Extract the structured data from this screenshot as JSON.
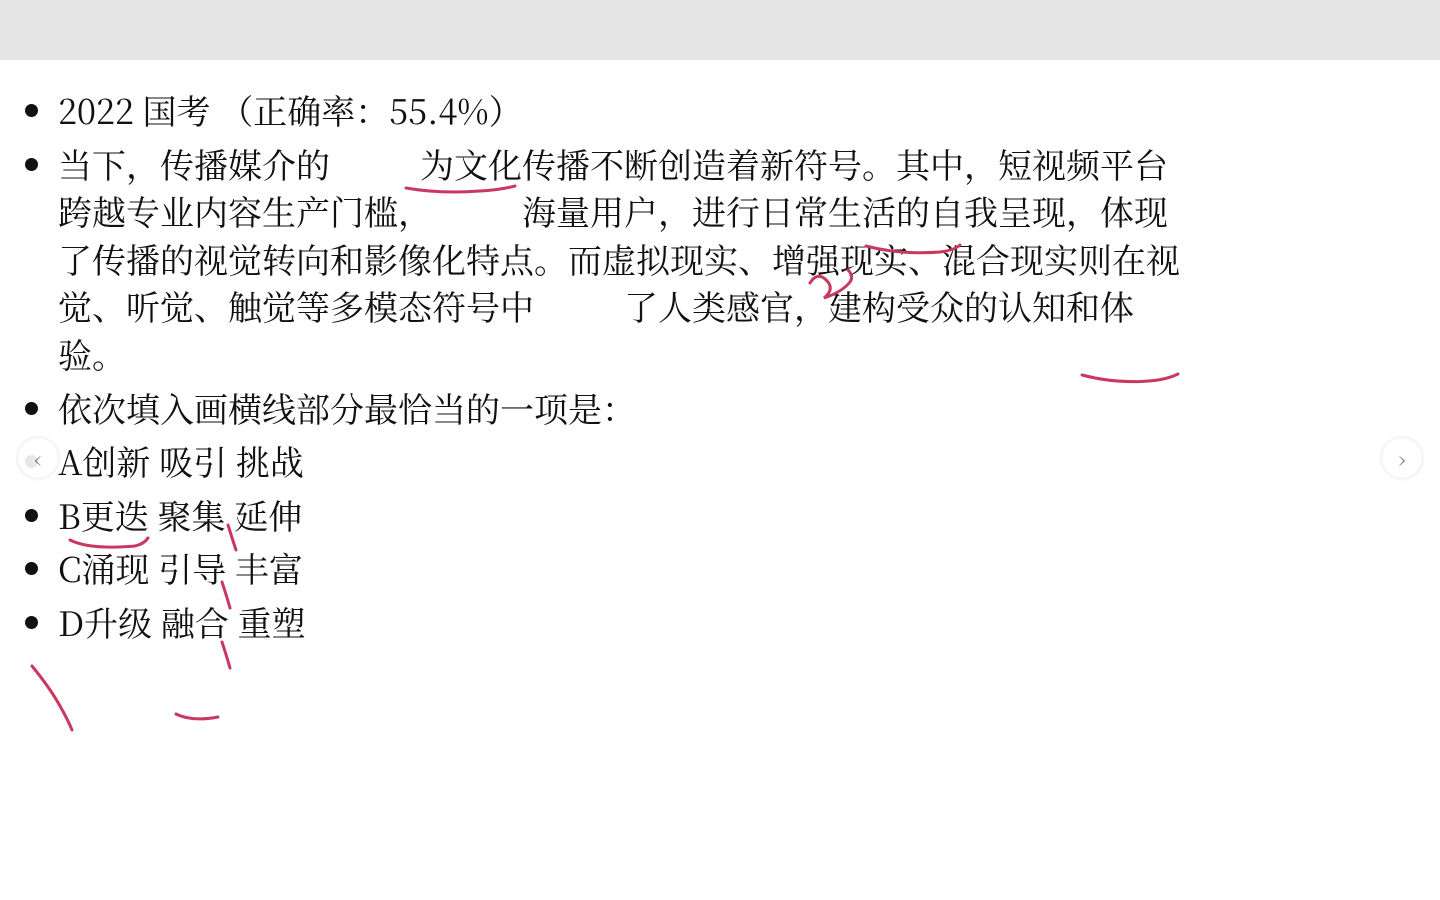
{
  "header": {
    "exam_label": "2022 国考",
    "accuracy_label_prefix": "（正确率：",
    "accuracy_value": "55.4%",
    "accuracy_label_suffix": "）"
  },
  "passage": {
    "seg1": "当下，传播媒介的",
    "seg2": "为文化传播不断创造着新符号。其中，短视频平台跨越专业内容生产门槛，",
    "seg3": "海量用户，进行日常生活的自我呈现，体现了传播的视觉转向和影像化特点。而虚拟现实、增强现实、混合现实则在视觉、听觉、触觉等多模态符号中",
    "seg4": "了人类感官，建构受众的认知和体验。"
  },
  "question_prompt": "依次填入画横线部分最恰当的一项是：",
  "options": {
    "A": "A创新 吸引 挑战",
    "B": "B更迭 聚集 延伸",
    "C": "C涌现 引导 丰富",
    "D": "D升级 融合 重塑"
  },
  "nav": {
    "prev": "‹",
    "next": "›"
  },
  "annotations": {
    "color": "#c9385e",
    "strokes": [
      "M406 128 Q 440 134 480 131 500 130 515 126",
      "M866 186 Q 900 195 940 192 955 190 960 185",
      "M810 223 Q 818 210 828 222 834 230 824 238 Q 842 232 850 222 854 216 848 210",
      "M1082 315 Q 1120 325 1158 320 1170 318 1178 314",
      "M70 480 Q 90 490 135 486 144 484 148 478",
      "M228 465 Q 232 478 236 490",
      "M222 522 Q 226 534 230 548",
      "M222 582 Q 226 594 230 608",
      "M32 606 Q 50 628 60 646 68 660 72 670",
      "M176 654 Q 192 662 218 657"
    ]
  }
}
